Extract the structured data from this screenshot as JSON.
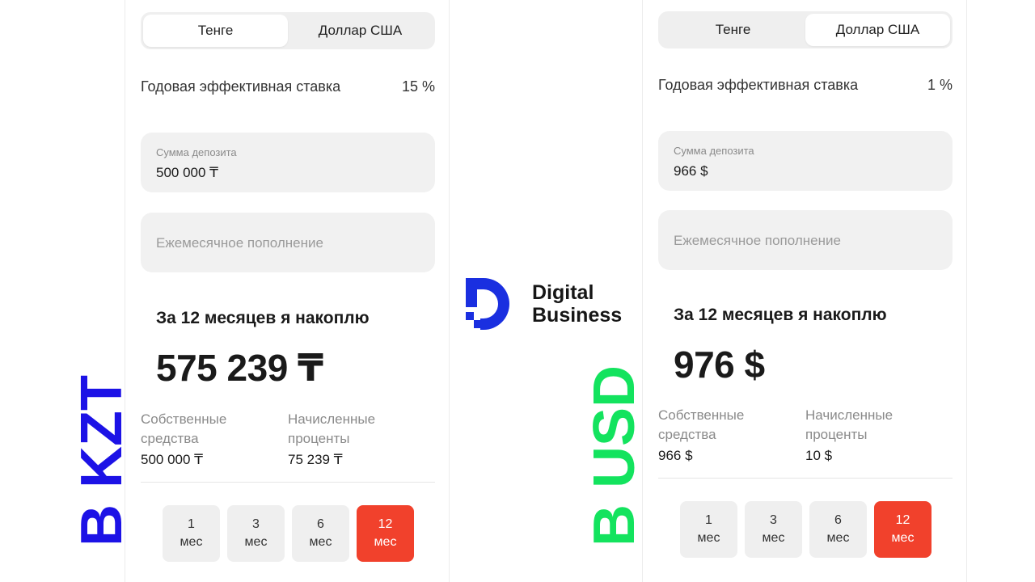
{
  "brand": {
    "line1": "Digital",
    "line2": "Business",
    "accent": "#1a2fe0"
  },
  "side_labels": {
    "kzt": "В KZT",
    "usd": "В USD"
  },
  "colors": {
    "kzt_label": "#1c12e6",
    "usd_label": "#13e35e",
    "active_term": "#f1412c"
  },
  "panels": {
    "kzt": {
      "tabs": [
        {
          "label": "Тенге",
          "active": true
        },
        {
          "label": "Доллар США",
          "active": false
        }
      ],
      "rate_label": "Годовая эффективная ставка",
      "rate_value": "15 %",
      "deposit_label": "Сумма депозита",
      "deposit_value": "500 000 ₸",
      "topup_placeholder": "Ежемесячное пополнение",
      "result_heading": "За 12 месяцев я накоплю",
      "result_amount": "575 239 ₸",
      "own_funds_label_1": "Собственные",
      "own_funds_label_2": "средства",
      "own_funds_value": "500 000 ₸",
      "interest_label_1": "Начисленные",
      "interest_label_2": "проценты",
      "interest_value": "75 239 ₸",
      "terms": [
        {
          "num": "1",
          "unit": "мес"
        },
        {
          "num": "3",
          "unit": "мес"
        },
        {
          "num": "6",
          "unit": "мес"
        },
        {
          "num": "12",
          "unit": "мес"
        }
      ],
      "active_term": "12"
    },
    "usd": {
      "tabs": [
        {
          "label": "Тенге",
          "active": false
        },
        {
          "label": "Доллар США",
          "active": true
        }
      ],
      "rate_label": "Годовая эффективная ставка",
      "rate_value": "1 %",
      "deposit_label": "Сумма депозита",
      "deposit_value": "966 $",
      "topup_placeholder": "Ежемесячное пополнение",
      "result_heading": "За 12 месяцев я накоплю",
      "result_amount": "976 $",
      "own_funds_label_1": "Собственные",
      "own_funds_label_2": "средства",
      "own_funds_value": "966 $",
      "interest_label_1": "Начисленные",
      "interest_label_2": "проценты",
      "interest_value": "10 $",
      "terms": [
        {
          "num": "1",
          "unit": "мес"
        },
        {
          "num": "3",
          "unit": "мес"
        },
        {
          "num": "6",
          "unit": "мес"
        },
        {
          "num": "12",
          "unit": "мес"
        }
      ],
      "active_term": "12"
    }
  }
}
